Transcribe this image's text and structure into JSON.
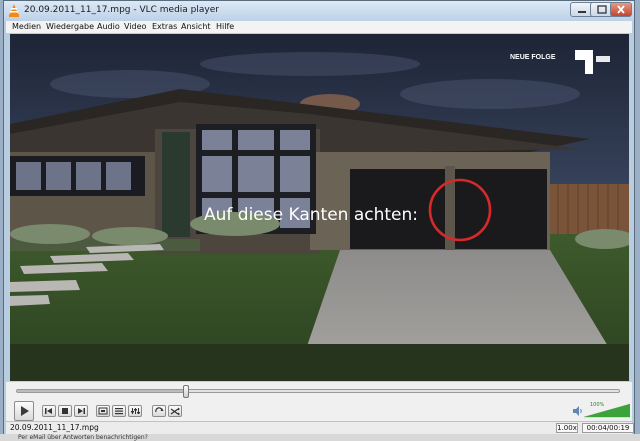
{
  "window": {
    "title": "20.09.2011_11_17.mpg - VLC media player"
  },
  "menubar": {
    "items": [
      "Medien",
      "Wiedergabe",
      "Audio",
      "Video",
      "Extras",
      "Ansicht",
      "Hilfe"
    ]
  },
  "video": {
    "overlay_text": "Auf diese Kanten achten:",
    "channel_logo_text": "NEUE FOLGE"
  },
  "playback": {
    "progress_fraction": 0.28
  },
  "volume": {
    "level_text": "100%",
    "level_fraction": 1.0
  },
  "status": {
    "filename": "20.09.2011_11_17.mpg",
    "speed": "1.00x",
    "time": "00:04/00:19"
  },
  "background": {
    "text": "Per eMail über Antworten benachrichtigen?"
  },
  "colors": {
    "accent": "#3a7bd5",
    "annotation_circle": "#d62a2a"
  }
}
